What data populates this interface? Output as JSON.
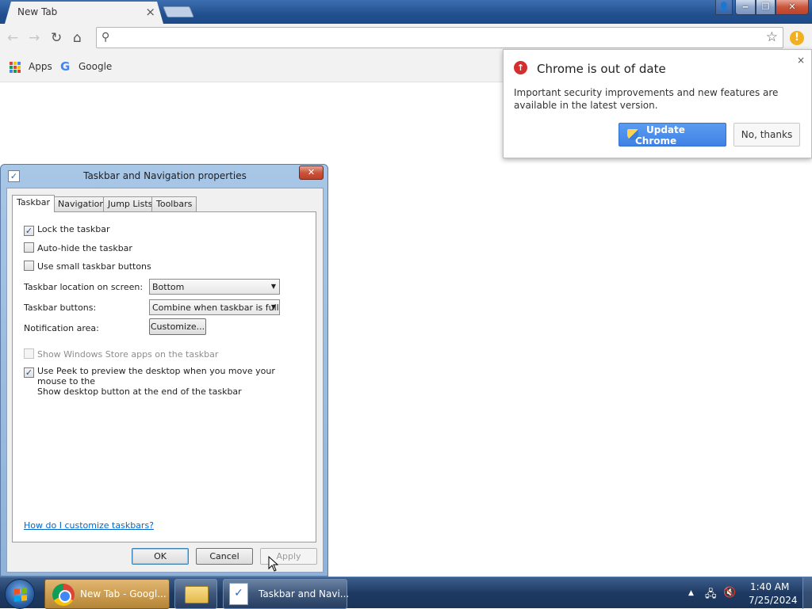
{
  "browser": {
    "tab_title": "New Tab",
    "tab_close": "×",
    "bookmarks": [
      {
        "label": "Apps"
      },
      {
        "label": "Google"
      }
    ],
    "omnibox_value": ""
  },
  "bubble": {
    "title": "Chrome is out of date",
    "body": "Important security improvements and new features are available in the latest version.",
    "update_label": "Update Chrome",
    "dismiss_label": "No, thanks",
    "close": "×"
  },
  "dialog": {
    "title": "Taskbar and Navigation properties",
    "tabs": [
      "Taskbar",
      "Navigation",
      "Jump Lists",
      "Toolbars"
    ],
    "active_tab": "Taskbar",
    "checkboxes": [
      {
        "label": "Lock the taskbar",
        "checked": true
      },
      {
        "label": "Auto-hide the taskbar",
        "checked": false
      },
      {
        "label": "Use small taskbar buttons",
        "checked": false
      },
      {
        "label": "Show Windows Store apps on the taskbar",
        "checked": false,
        "disabled": true
      },
      {
        "label": "Use Peek to preview the desktop when you move your mouse to the",
        "label2": "Show desktop button at the end of the taskbar",
        "checked": true
      }
    ],
    "location_label": "Taskbar location on screen:",
    "location_value": "Bottom",
    "buttons_label": "Taskbar buttons:",
    "buttons_value": "Combine when taskbar is full",
    "notification_label": "Notification area:",
    "customize_label": "Customize...",
    "help_link": "How do I customize taskbars?",
    "ok_label": "OK",
    "cancel_label": "Cancel",
    "apply_label": "Apply"
  },
  "taskbar": {
    "tasks": [
      {
        "label": "New Tab - Googl..."
      },
      {
        "label": ""
      },
      {
        "label": "Taskbar and Navi..."
      }
    ],
    "time": "1:40 AM",
    "date": "7/25/2024"
  },
  "colors": {
    "accent_blue": "#4285f4",
    "update_button": "#3f82e5",
    "alert_red": "#d32f2f",
    "alert_yellow": "#f2b01e"
  }
}
